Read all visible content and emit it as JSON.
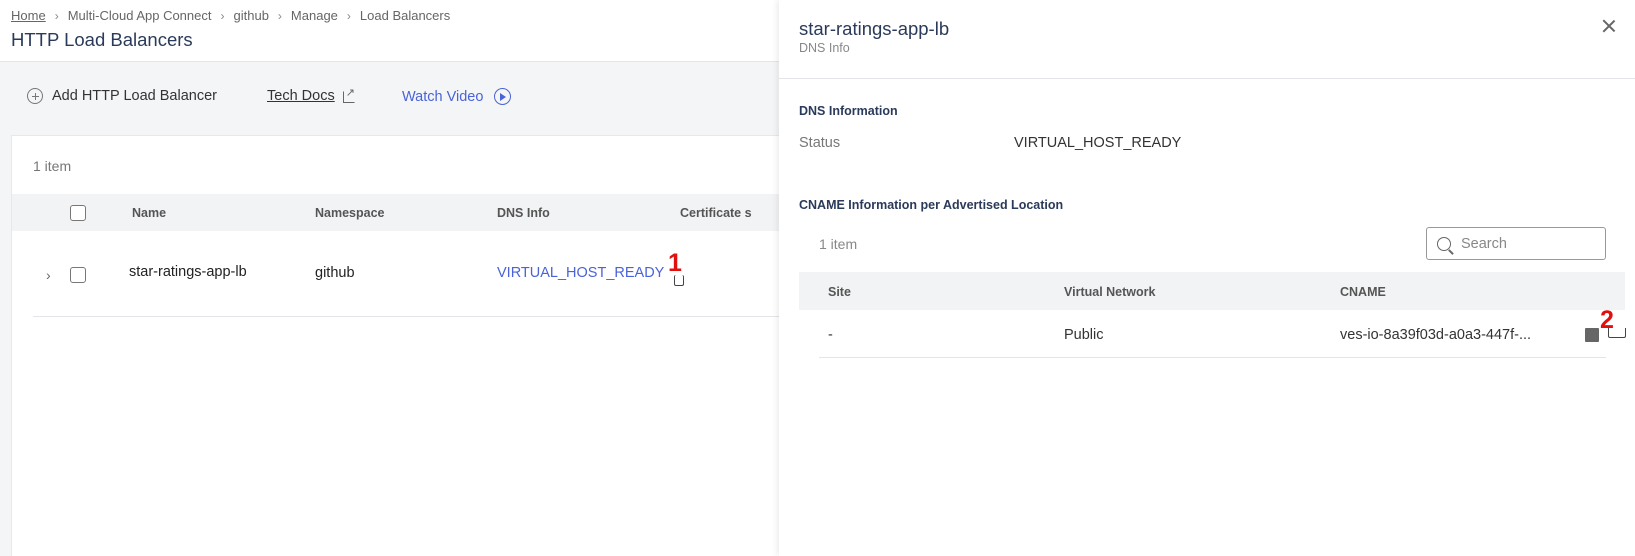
{
  "breadcrumb": [
    "Home",
    "Multi-Cloud App Connect",
    "github",
    "Manage",
    "Load Balancers"
  ],
  "page_title": "HTTP Load Balancers",
  "toolbar": {
    "add_label": "Add HTTP Load Balancer",
    "docs_label": "Tech Docs",
    "video_label": "Watch Video"
  },
  "table": {
    "item_count": "1 item",
    "headers": {
      "name": "Name",
      "namespace": "Namespace",
      "dns_info": "DNS Info",
      "certificate": "Certificate s"
    },
    "row": {
      "name": "star-ratings-app-lb",
      "namespace": "github",
      "dns_info": "VIRTUAL_HOST_READY"
    }
  },
  "markers": {
    "one": "1",
    "two": "2"
  },
  "panel": {
    "title": "star-ratings-app-lb",
    "subtitle": "DNS Info",
    "dns_section_title": "DNS Information",
    "status_label": "Status",
    "status_value": "VIRTUAL_HOST_READY",
    "cname_section_title": "CNAME Information per Advertised Location",
    "item_count": "1 item",
    "search_placeholder": "Search",
    "headers": {
      "site": "Site",
      "virtual_network": "Virtual Network",
      "cname": "CNAME"
    },
    "row": {
      "site": "-",
      "virtual_network": "Public",
      "cname": "ves-io-8a39f03d-a0a3-447f-..."
    }
  },
  "colors": {
    "link": "#4a63d8",
    "marker": "#e01010",
    "title": "#2a3a5a"
  }
}
